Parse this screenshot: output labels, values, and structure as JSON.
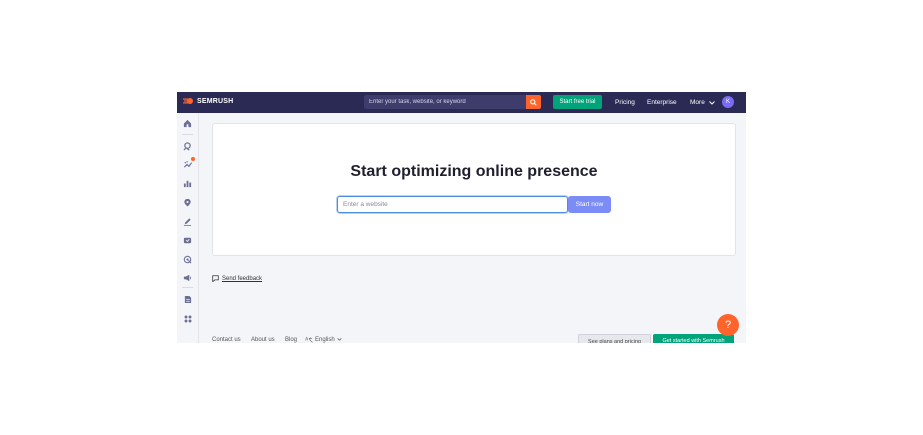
{
  "header": {
    "logo_text": "SEMRUSH",
    "search_placeholder": "Enter your task, website, or keyword",
    "trial_label": "Start free trial",
    "nav": [
      "Pricing",
      "Enterprise",
      "More"
    ],
    "avatar_initial": "K"
  },
  "sidebar": {
    "icons": [
      "home-icon",
      "seo-icon",
      "local-trends-icon",
      "chart-icon",
      "location-icon",
      "content-pen-icon",
      "social-icon",
      "ads-target-icon",
      "megaphone-icon",
      "document-icon",
      "apps-icon"
    ],
    "notification_color": "#ff642d"
  },
  "main": {
    "headline": "Start optimizing online presence",
    "input_placeholder": "Enter a website",
    "start_label": "Start now",
    "feedback_label": "Send feedback"
  },
  "footer": {
    "links": [
      "Contact us",
      "About us",
      "Blog"
    ],
    "language": "English",
    "plans_label": "See plans and pricing",
    "get_started_label": "Get started with Semrush"
  },
  "help_label": "?",
  "colors": {
    "topbar": "#2b2a55",
    "accent_orange": "#ff642d",
    "green": "#00a37a",
    "start_btn": "#7c8cf7"
  }
}
